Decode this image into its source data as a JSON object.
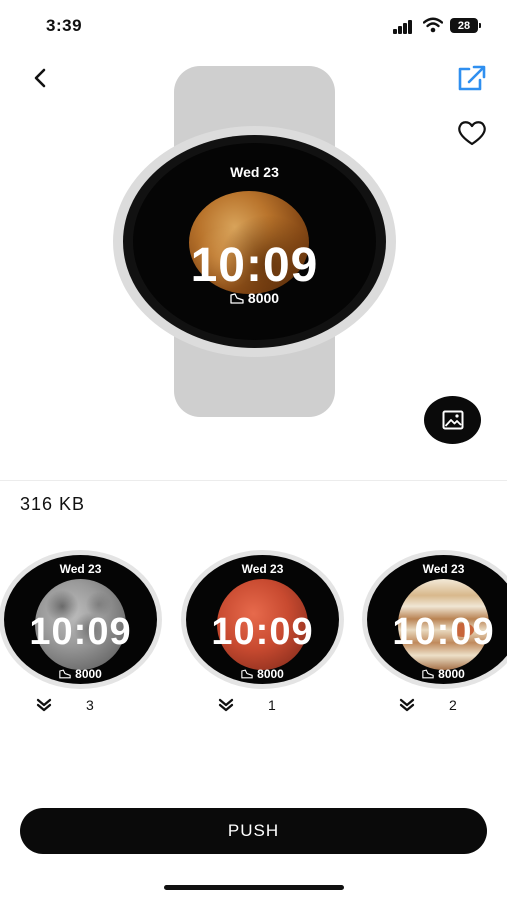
{
  "status_bar": {
    "time": "3:39",
    "battery": "28"
  },
  "hero": {
    "date": "Wed 23",
    "time": "10:09",
    "steps": "8000"
  },
  "file": {
    "size": "316 KB"
  },
  "faces": [
    {
      "date": "Wed 23",
      "time": "10:09",
      "steps": "8000",
      "downloads": "3",
      "planet": "moon"
    },
    {
      "date": "Wed 23",
      "time": "10:09",
      "steps": "8000",
      "downloads": "1",
      "planet": "mars"
    },
    {
      "date": "Wed 23",
      "time": "10:09",
      "steps": "8000",
      "downloads": "2",
      "planet": "jupiter"
    }
  ],
  "actions": {
    "push_label": "PUSH"
  },
  "icons": {
    "back": "chevron-left-icon",
    "share": "external-link-icon",
    "favorite": "heart-icon",
    "image": "image-icon",
    "steps": "shoe-icon",
    "downloads": "double-chevron-down-icon"
  },
  "colors": {
    "accent": "#2f8ff0",
    "button": "#0a0a0a",
    "strap": "#cfcfcf"
  }
}
